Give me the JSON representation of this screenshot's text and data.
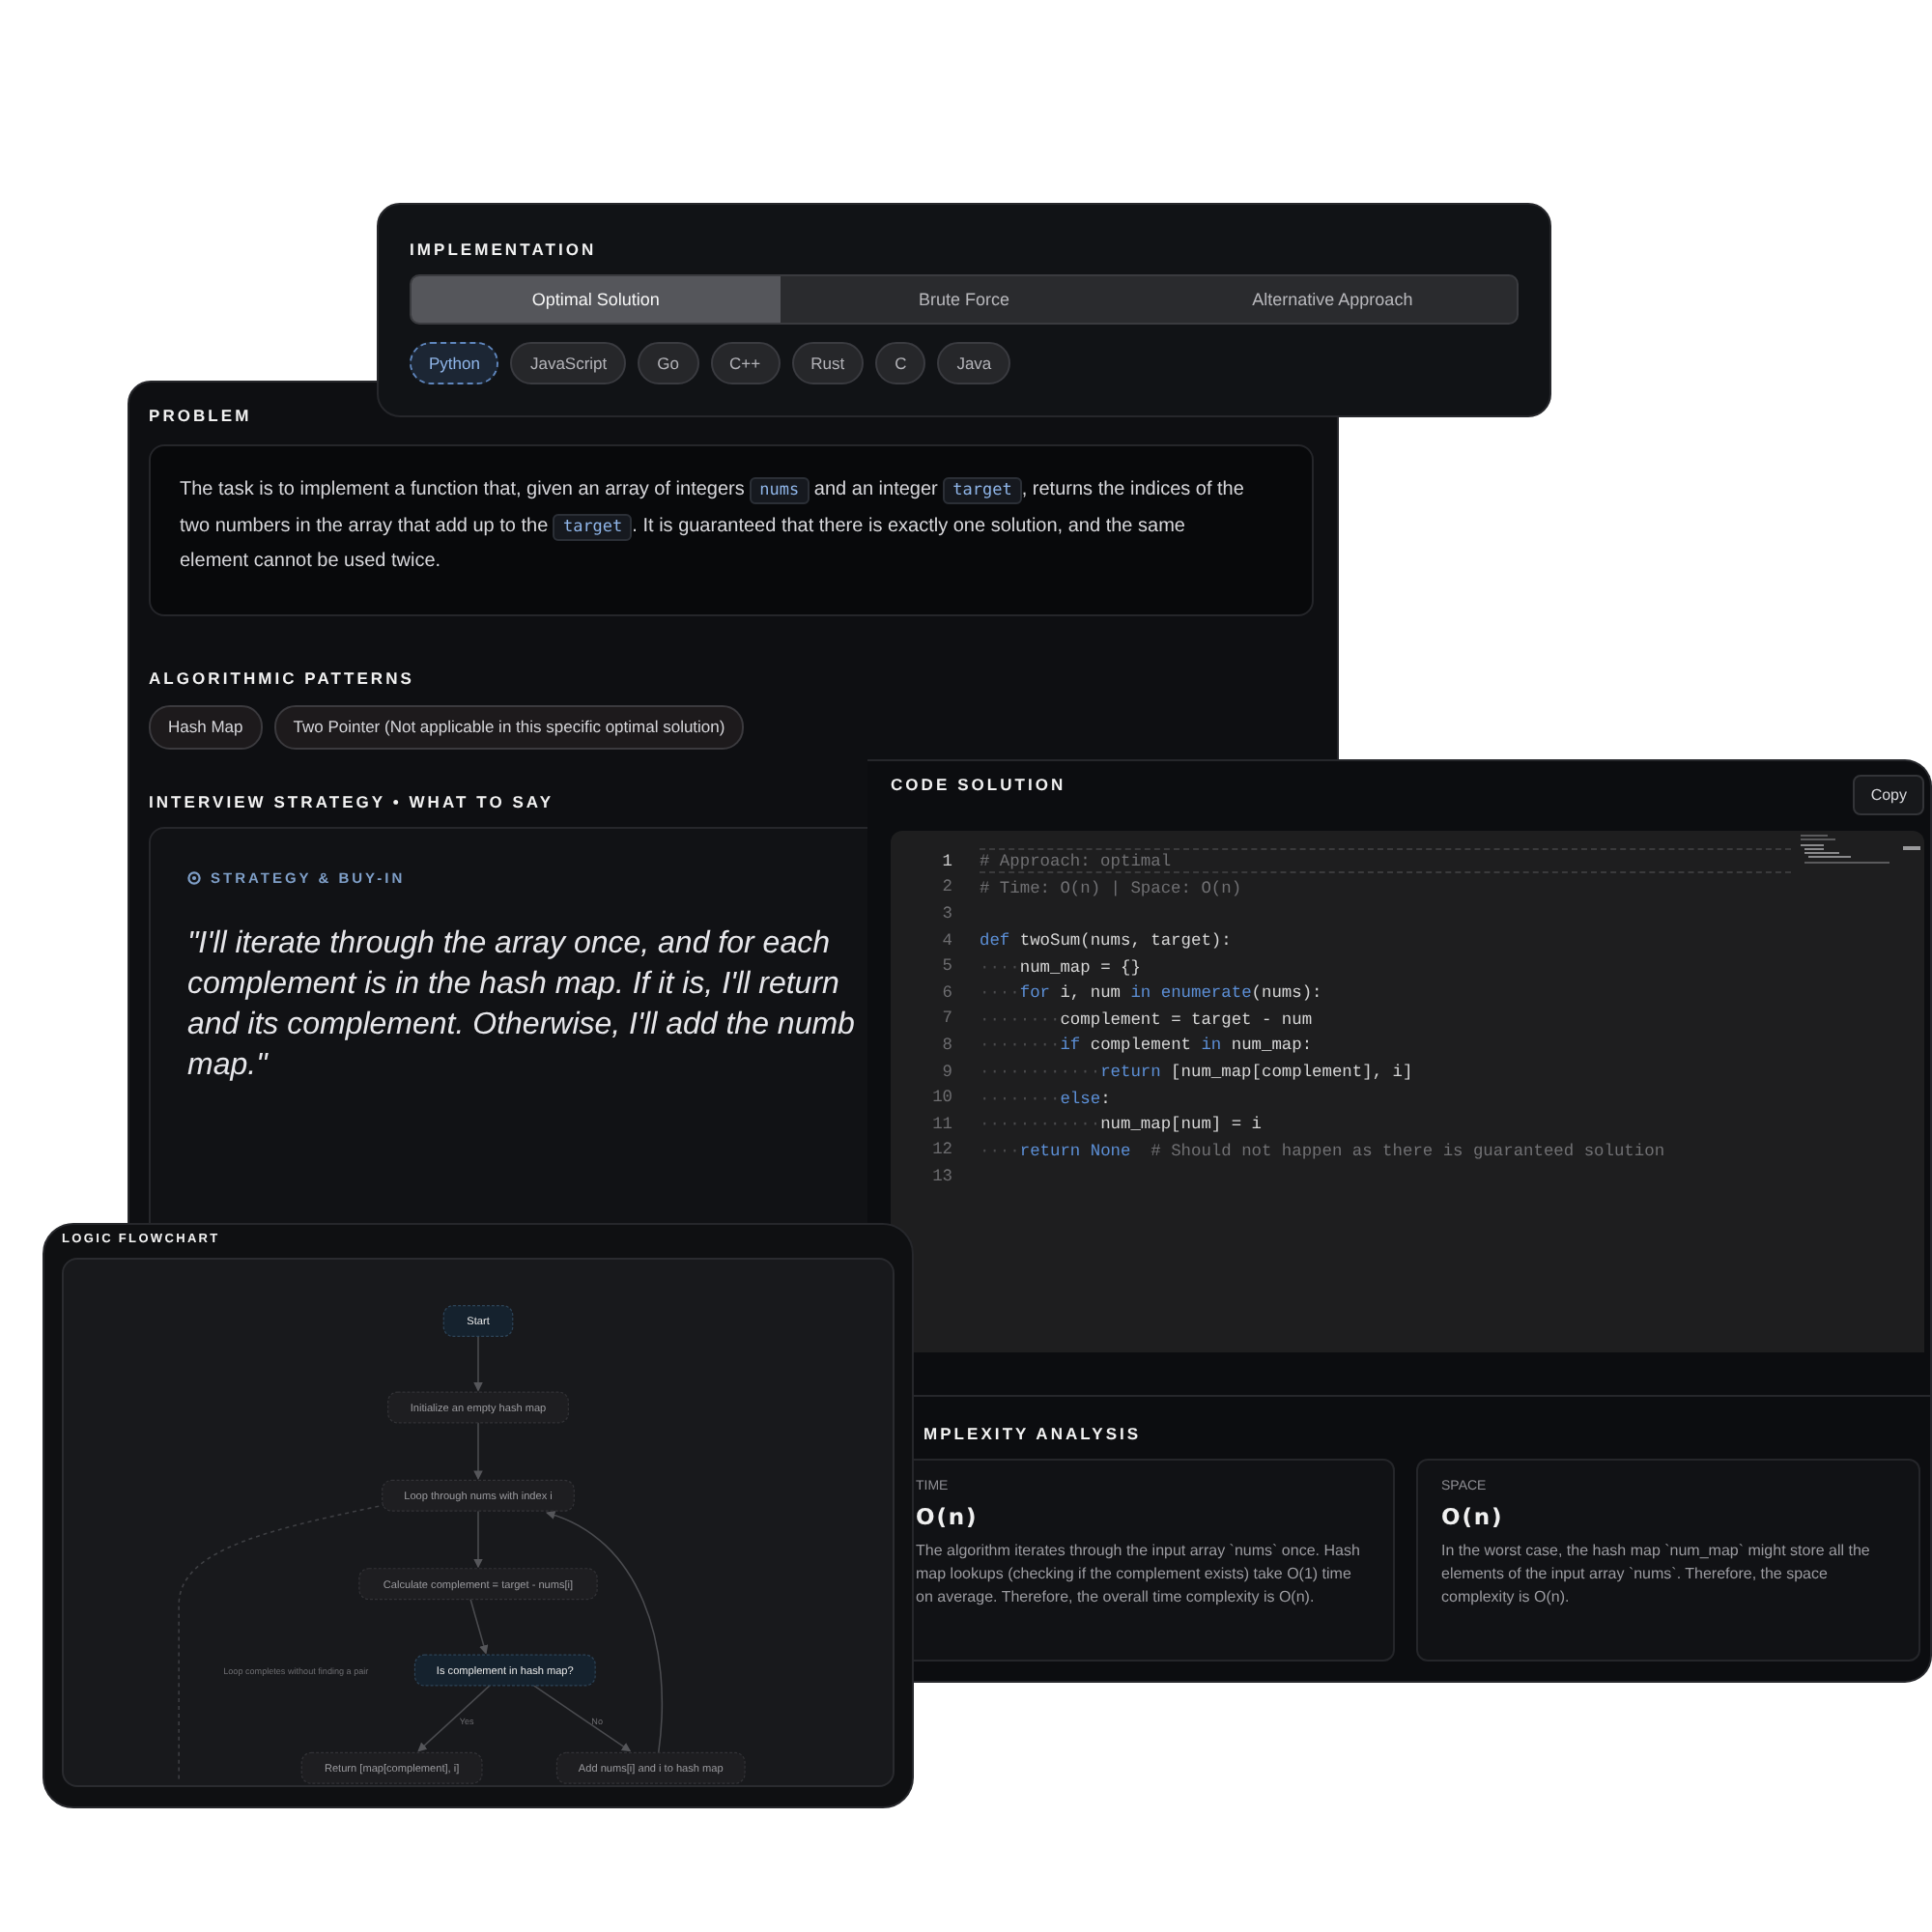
{
  "implementation": {
    "title": "IMPLEMENTATION",
    "tabs": [
      {
        "label": "Optimal Solution",
        "selected": true
      },
      {
        "label": "Brute Force",
        "selected": false
      },
      {
        "label": "Alternative Approach",
        "selected": false
      }
    ],
    "languages": [
      {
        "label": "Python",
        "selected": true
      },
      {
        "label": "JavaScript",
        "selected": false
      },
      {
        "label": "Go",
        "selected": false
      },
      {
        "label": "C++",
        "selected": false
      },
      {
        "label": "Rust",
        "selected": false
      },
      {
        "label": "C",
        "selected": false
      },
      {
        "label": "Java",
        "selected": false
      }
    ]
  },
  "problem": {
    "title": "PROBLEM",
    "segments": [
      {
        "kind": "text",
        "text": "The task is to implement a function that, given an array of integers "
      },
      {
        "kind": "code",
        "text": "nums"
      },
      {
        "kind": "text",
        "text": " and an integer "
      },
      {
        "kind": "code",
        "text": "target"
      },
      {
        "kind": "text",
        "text": ", returns the indices of the two numbers in the array that add up to the "
      },
      {
        "kind": "code",
        "text": "target"
      },
      {
        "kind": "text",
        "text": ". It is guaranteed that there is exactly one solution, and the same element cannot be used twice."
      }
    ]
  },
  "patterns": {
    "title": "ALGORITHMIC PATTERNS",
    "items": [
      "Hash Map",
      "Two Pointer (Not applicable in this specific optimal solution)"
    ]
  },
  "strategy": {
    "title": "INTERVIEW STRATEGY • WHAT TO SAY",
    "label": "STRATEGY & BUY-IN",
    "quote_lines": [
      "\"I'll iterate through the array once, and for each",
      "complement is in the hash map. If it is, I'll return",
      "and its complement. Otherwise, I'll add the numb",
      "map.\""
    ]
  },
  "code_solution": {
    "title": "CODE SOLUTION",
    "copy_button": "Copy",
    "lines": [
      {
        "number": "1",
        "current": true,
        "tokens": [
          {
            "kind": "comment",
            "text": "# Approach: optimal"
          }
        ]
      },
      {
        "number": "2",
        "current": false,
        "tokens": [
          {
            "kind": "comment",
            "text": "# Time: O(n) | Space: O(n)"
          }
        ]
      },
      {
        "number": "3",
        "current": false
      },
      {
        "number": "4",
        "current": false,
        "tokens": [
          {
            "kind": "keyword",
            "text": "def"
          },
          {
            "kind": "plain",
            "text": " twoSum(nums, target):"
          }
        ]
      },
      {
        "number": "5",
        "current": false,
        "tokens": [
          {
            "kind": "indent",
            "text": "····"
          },
          {
            "kind": "plain",
            "text": "num_map = {}"
          }
        ]
      },
      {
        "number": "6",
        "current": false,
        "tokens": [
          {
            "kind": "indent",
            "text": "····"
          },
          {
            "kind": "keyword",
            "text": "for"
          },
          {
            "kind": "plain",
            "text": " i, num "
          },
          {
            "kind": "keyword",
            "text": "in "
          },
          {
            "kind": "keyword",
            "text": "enumerate"
          },
          {
            "kind": "plain",
            "text": "(nums):"
          }
        ]
      },
      {
        "number": "7",
        "current": false,
        "tokens": [
          {
            "kind": "indent",
            "text": "········"
          },
          {
            "kind": "plain",
            "text": "complement = target - num"
          }
        ]
      },
      {
        "number": "8",
        "current": false,
        "tokens": [
          {
            "kind": "indent",
            "text": "········"
          },
          {
            "kind": "keyword",
            "text": "if"
          },
          {
            "kind": "plain",
            "text": " complement "
          },
          {
            "kind": "keyword",
            "text": "in"
          },
          {
            "kind": "plain",
            "text": " num_map:"
          }
        ]
      },
      {
        "number": "9",
        "current": false,
        "tokens": [
          {
            "kind": "indent",
            "text": "············"
          },
          {
            "kind": "keyword",
            "text": "return"
          },
          {
            "kind": "plain",
            "text": " [num_map[complement], i]"
          }
        ]
      },
      {
        "number": "10",
        "current": false,
        "tokens": [
          {
            "kind": "indent",
            "text": "········"
          },
          {
            "kind": "keyword",
            "text": "else"
          },
          {
            "kind": "plain",
            "text": ":"
          }
        ]
      },
      {
        "number": "11",
        "current": false,
        "tokens": [
          {
            "kind": "indent",
            "text": "············"
          },
          {
            "kind": "plain",
            "text": "num_map[num] = i"
          }
        ]
      },
      {
        "number": "12",
        "current": false,
        "tokens": [
          {
            "kind": "indent",
            "text": "····"
          },
          {
            "kind": "keyword",
            "text": "return None"
          },
          {
            "kind": "comment",
            "text": "  # Should not happen as there is guaranteed solution"
          }
        ]
      },
      {
        "number": "13",
        "current": false
      }
    ]
  },
  "complexity": {
    "title": "MPLEXITY ANALYSIS",
    "cards": [
      {
        "label": "TIME",
        "value": "O(n)",
        "description": "The algorithm iterates through the input array `nums` once. Hash map lookups (checking if the complement exists) take O(1) time on average. Therefore, the overall time complexity is O(n)."
      },
      {
        "label": "SPACE",
        "value": "O(n)",
        "description": "In the worst case, the hash map `num_map` might store all the elements of the input array `nums`. Therefore, the space complexity is O(n)."
      }
    ]
  },
  "flowchart": {
    "title": "LOGIC FLOWCHART",
    "nodes": [
      {
        "label": "Start",
        "kind": "terminal"
      },
      {
        "label": "Initialize an empty hash map",
        "kind": "process"
      },
      {
        "label": "Loop through nums with index i",
        "kind": "process"
      },
      {
        "label": "Calculate complement = target - nums[i]",
        "kind": "process"
      },
      {
        "label": "Is complement in hash map?",
        "kind": "decision"
      },
      {
        "label": "Return [map[complement], i]",
        "kind": "process"
      },
      {
        "label": "Add nums[i] and i to hash map",
        "kind": "process"
      }
    ],
    "edge_labels": [
      "Loop completes without finding a pair",
      "Yes",
      "No"
    ]
  }
}
